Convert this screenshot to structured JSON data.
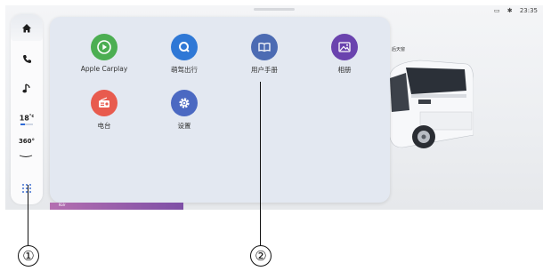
{
  "status_bar": {
    "icons": [
      "sim-icon",
      "bluetooth-icon"
    ],
    "time": "23:35"
  },
  "scene": {
    "label": "后天窗"
  },
  "dock": {
    "items": [
      {
        "icon": "home-icon",
        "active": true
      },
      {
        "icon": "phone-icon"
      },
      {
        "icon": "music-icon"
      },
      {
        "icon": "temperature-control",
        "value": "18",
        "unit": "°c"
      },
      {
        "icon": "view-360-icon",
        "value": "360°"
      },
      {
        "icon": "apps-grid-icon"
      }
    ]
  },
  "launcher": {
    "apps": [
      {
        "label": "Apple Carplay",
        "icon": "carplay-icon",
        "color": "#4cae52"
      },
      {
        "label": "萌驾出行",
        "icon": "search-icon",
        "color": "#2f78d6"
      },
      {
        "label": "用户手册",
        "icon": "book-icon",
        "color": "#4c6bb3"
      },
      {
        "label": "相册",
        "icon": "gallery-icon",
        "color": "#6a43ae"
      },
      {
        "label": "电台",
        "icon": "radio-icon",
        "color": "#e85b4e"
      },
      {
        "label": "设置",
        "icon": "gear-icon",
        "color": "#4b69c2"
      }
    ]
  },
  "bottom_strip": {
    "label": "Kolr"
  },
  "callouts": {
    "one": "①",
    "two": "②"
  }
}
